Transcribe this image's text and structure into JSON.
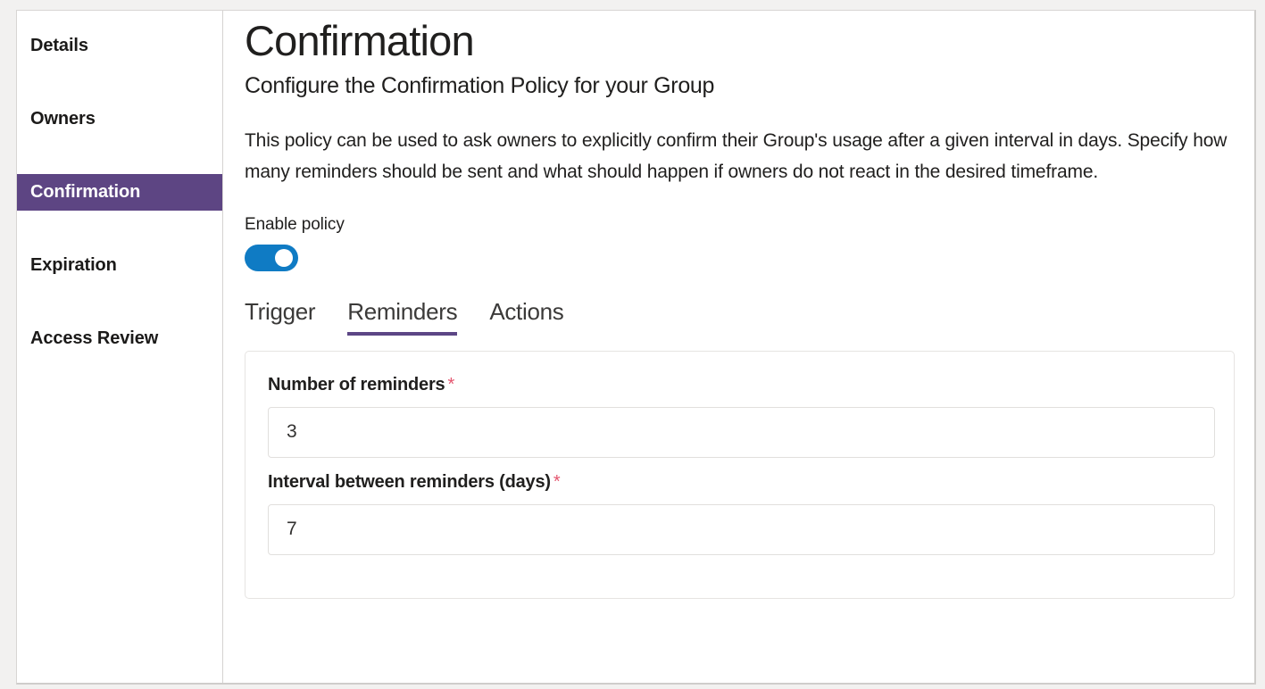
{
  "sidebar": {
    "items": [
      {
        "label": "Details",
        "selected": false
      },
      {
        "label": "Owners",
        "selected": false
      },
      {
        "label": "Confirmation",
        "selected": true
      },
      {
        "label": "Expiration",
        "selected": false
      },
      {
        "label": "Access Review",
        "selected": false
      }
    ]
  },
  "header": {
    "title": "Confirmation",
    "subtitle": "Configure the Confirmation Policy for your Group",
    "description": "This policy can be used to ask owners to explicitly confirm their Group's usage after a given interval in days. Specify how many reminders should be sent and what should happen if owners do not react in the desired timeframe."
  },
  "enable_policy": {
    "label": "Enable policy",
    "toggle_state": "on"
  },
  "tabs": [
    {
      "label": "Trigger",
      "active": false
    },
    {
      "label": "Reminders",
      "active": true
    },
    {
      "label": "Actions",
      "active": false
    }
  ],
  "form": {
    "fields": [
      {
        "label": "Number of reminders",
        "required_marker": "*",
        "value": "3",
        "placeholder": ""
      },
      {
        "label": "Interval between reminders (days)",
        "required_marker": "*",
        "value": "7",
        "placeholder": ""
      }
    ]
  },
  "colors": {
    "accent_purple": "#5d4583",
    "tab_underline": "#5c4685",
    "toggle_on": "#0f7bc4",
    "required_star": "#e4566f",
    "page_background": "#f2f1f0"
  }
}
